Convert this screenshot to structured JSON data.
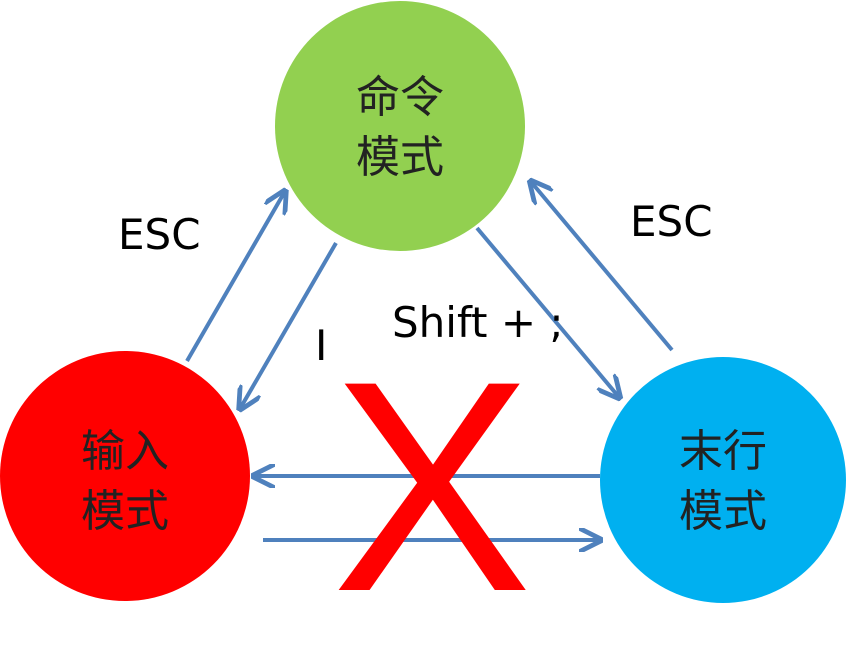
{
  "nodes": {
    "command": {
      "line1": "命令",
      "line2": "模式",
      "color": "#92d050"
    },
    "insert": {
      "line1": "输入",
      "line2": "模式",
      "color": "#ff0000"
    },
    "lastline": {
      "line1": "末行",
      "line2": "模式",
      "color": "#00b0f0"
    }
  },
  "edges": {
    "insert_to_command": "ESC",
    "command_to_insert": "I",
    "command_to_lastline": "Shift + ;",
    "lastline_to_command": "ESC"
  },
  "forbidden_mark": "X",
  "colors": {
    "arrow": "#4f81bd",
    "forbidden": "#ff0000"
  }
}
